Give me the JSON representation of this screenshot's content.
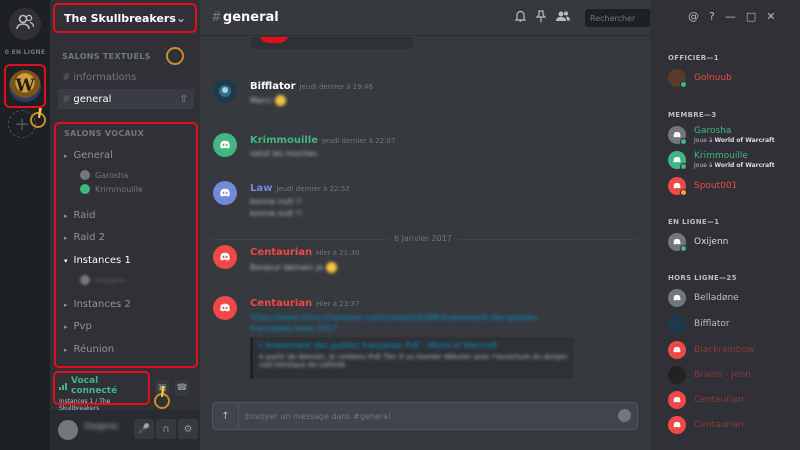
{
  "guild_rail": {
    "online_label": "0 EN LIGNE",
    "server_initial": "W",
    "add_label": "+"
  },
  "sidebar": {
    "server_name": "The Skullbreakers",
    "text_category": "SALONS TEXTUELS",
    "text_channels": [
      {
        "name": "informations"
      },
      {
        "name": "general"
      }
    ],
    "voice_category": "SALONS VOCAUX",
    "voice_channels": [
      {
        "name": "General"
      },
      {
        "name": "Raid"
      },
      {
        "name": "Raid 2"
      },
      {
        "name": "Instances 1"
      },
      {
        "name": "Instances 2"
      },
      {
        "name": "Pvp"
      },
      {
        "name": "Réunion"
      }
    ],
    "voice_users_general": [
      "Garosha",
      "Krimmouille"
    ],
    "voice_users_instances": [
      "Oxijenn"
    ],
    "voice_status": {
      "title": "Vocal connecté",
      "subtitle": "Instances 1 / The Skullbreakers"
    },
    "user_panel": {
      "username": "Oxijenn"
    }
  },
  "header": {
    "hash": "#",
    "channel": "general",
    "search_placeholder": "Rechercher"
  },
  "messages": [
    {
      "author": "Bifflator",
      "time": "Jeudi dernier à 19:46",
      "color": "#ffffff",
      "avatar_color": "#1e3a4a",
      "lines": [
        "Merci"
      ]
    },
    {
      "author": "Krimmouille",
      "time": "Jeudi dernier à 22:07",
      "color": "#43b581",
      "avatar_color": "#43b581",
      "lines": [
        "salut les moches"
      ]
    },
    {
      "author": "Law",
      "time": "Jeudi dernier à 22:52",
      "color": "#7289da",
      "avatar_color": "#7289da",
      "lines": [
        "bonne nuit !!",
        "bonne nuit !!"
      ]
    },
    {
      "author": "Centaurian",
      "time": "Hier à 21:30",
      "color": "#f04747",
      "avatar_color": "#f04747",
      "lines": [
        "Bonjour demain je"
      ]
    },
    {
      "author": "Centaurian",
      "time": "Hier à 23:37",
      "color": "#f04747",
      "avatar_color": "#f04747",
      "lines": []
    }
  ],
  "date_divider": "6 janvier 2017",
  "link_message": "https://www.mmo-champion.com/content/6398-Evenement-des-guildes-Francaises-avec-2017",
  "link_embed": {
    "title": "L'évènement des guildes françaises PvE - World of Warcraft",
    "description": "A partir de demain, le contenu PvE Tier 9 va monter débuter avec l'ouverture du donjon raid héroïque de Lothrek"
  },
  "composer": {
    "placeholder": "Envoyer un message dans #general"
  },
  "member_list": {
    "groups": [
      {
        "label": "OFFICIER—1",
        "members": [
          {
            "name": "Golnuub",
            "color": "#f04747",
            "avatar_color": "#5a3a2a",
            "status": "#43b581",
            "game": ""
          }
        ]
      },
      {
        "label": "MEMBRE—3",
        "members": [
          {
            "name": "Garosha",
            "color": "#43b581",
            "avatar_color": "#72767d",
            "status": "#43b581",
            "game_prefix": "Joue à",
            "game": "World of Warcraft"
          },
          {
            "name": "Krimmouille",
            "color": "#43b581",
            "avatar_color": "#43b581",
            "status": "#43b581",
            "game_prefix": "Joue à",
            "game": "World of Warcraft"
          },
          {
            "name": "Spout001",
            "color": "#f04747",
            "avatar_color": "#f04747",
            "status": "#faa61a",
            "game": ""
          }
        ]
      },
      {
        "label": "EN LIGNE—1",
        "members": [
          {
            "name": "Oxijenn",
            "color": "#dcddde",
            "avatar_color": "#72767d",
            "status": "#43b581",
            "game": ""
          }
        ]
      },
      {
        "label": "HORS LIGNE—25",
        "members": [
          {
            "name": "Belladøne",
            "color": "#b9bbbe",
            "avatar_color": "#72767d"
          },
          {
            "name": "Bifflator",
            "color": "#b9bbbe",
            "avatar_color": "#1e3a4a"
          },
          {
            "name": "Blackrainbow",
            "color": "#8a3a3a",
            "avatar_color": "#f04747"
          },
          {
            "name": "Brains - Jenn",
            "color": "#8a3a3a",
            "avatar_color": "#222222"
          },
          {
            "name": "Centaurian",
            "color": "#8a3a3a",
            "avatar_color": "#f04747"
          },
          {
            "name": "Centaurian",
            "color": "#8a3a3a",
            "avatar_color": "#f04747"
          }
        ]
      }
    ]
  }
}
